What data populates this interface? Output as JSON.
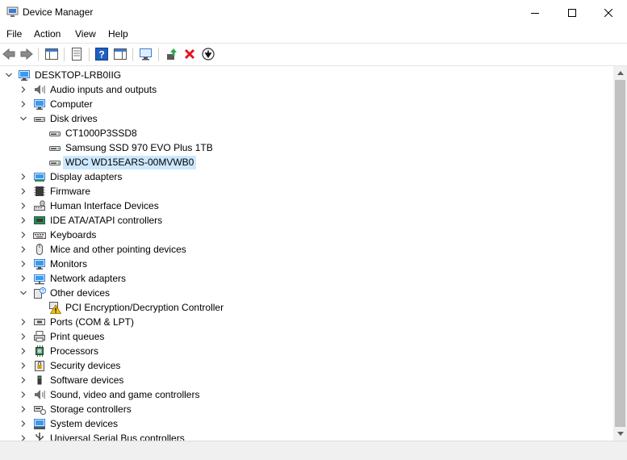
{
  "window": {
    "title": "Device Manager"
  },
  "menu": [
    "File",
    "Action",
    "View",
    "Help"
  ],
  "tree": {
    "root": "DESKTOP-LRB0IIG",
    "categories": [
      {
        "label": "Audio inputs and outputs",
        "icon": "speaker-icon",
        "expanded": false
      },
      {
        "label": "Computer",
        "icon": "computer-icon",
        "expanded": false
      },
      {
        "label": "Disk drives",
        "icon": "disk-drive-icon",
        "expanded": true,
        "children": [
          {
            "label": "CT1000P3SSD8",
            "icon": "disk-drive-icon"
          },
          {
            "label": "Samsung SSD 970 EVO Plus 1TB",
            "icon": "disk-drive-icon"
          },
          {
            "label": "WDC WD15EARS-00MVWB0",
            "icon": "disk-drive-icon",
            "selected": true
          }
        ]
      },
      {
        "label": "Display adapters",
        "icon": "display-adapter-icon",
        "expanded": false
      },
      {
        "label": "Firmware",
        "icon": "firmware-icon",
        "expanded": false
      },
      {
        "label": "Human Interface Devices",
        "icon": "hid-icon",
        "expanded": false
      },
      {
        "label": "IDE ATA/ATAPI controllers",
        "icon": "ide-controller-icon",
        "expanded": false
      },
      {
        "label": "Keyboards",
        "icon": "keyboard-icon",
        "expanded": false
      },
      {
        "label": "Mice and other pointing devices",
        "icon": "mouse-icon",
        "expanded": false
      },
      {
        "label": "Monitors",
        "icon": "monitor-icon",
        "expanded": false
      },
      {
        "label": "Network adapters",
        "icon": "network-adapter-icon",
        "expanded": false
      },
      {
        "label": "Other devices",
        "icon": "other-devices-icon",
        "expanded": true,
        "children": [
          {
            "label": "PCI Encryption/Decryption Controller",
            "icon": "warning-device-icon"
          }
        ]
      },
      {
        "label": "Ports (COM & LPT)",
        "icon": "port-icon",
        "expanded": false
      },
      {
        "label": "Print queues",
        "icon": "printer-icon",
        "expanded": false
      },
      {
        "label": "Processors",
        "icon": "processor-icon",
        "expanded": false
      },
      {
        "label": "Security devices",
        "icon": "security-device-icon",
        "expanded": false
      },
      {
        "label": "Software devices",
        "icon": "software-device-icon",
        "expanded": false
      },
      {
        "label": "Sound, video and game controllers",
        "icon": "sound-controller-icon",
        "expanded": false
      },
      {
        "label": "Storage controllers",
        "icon": "storage-controller-icon",
        "expanded": false
      },
      {
        "label": "System devices",
        "icon": "system-devices-icon",
        "expanded": false
      },
      {
        "label": "Universal Serial Bus controllers",
        "icon": "usb-controller-icon",
        "expanded": false
      }
    ]
  },
  "colors": {
    "selection": "#cce8ff",
    "remove_red": "#e81123",
    "help_blue": "#1f5fbf"
  }
}
